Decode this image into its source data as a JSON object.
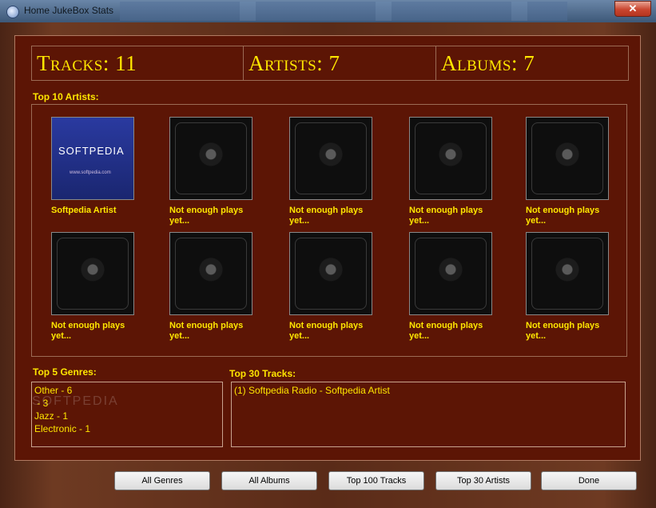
{
  "window": {
    "title": "Home JukeBox Stats",
    "close_glyph": "✕"
  },
  "stats": {
    "tracks": "Tracks: 11",
    "artists": "Artists: 7",
    "albums": "Albums: 7"
  },
  "top_artists": {
    "label": "Top 10 Artists:",
    "items": [
      {
        "name": "Softpedia Artist",
        "cover": "softpedia-cover",
        "logo": "SOFTPEDIA",
        "url": "www.softpedia.com"
      },
      {
        "name": "Not enough plays yet...",
        "cover": "empty-cd-case"
      },
      {
        "name": "Not enough plays yet...",
        "cover": "empty-cd-case"
      },
      {
        "name": "Not enough plays yet...",
        "cover": "empty-cd-case"
      },
      {
        "name": "Not enough plays yet...",
        "cover": "empty-cd-case"
      },
      {
        "name": "Not enough plays yet...",
        "cover": "empty-cd-case"
      },
      {
        "name": "Not enough plays yet...",
        "cover": "empty-cd-case"
      },
      {
        "name": "Not enough plays yet...",
        "cover": "empty-cd-case"
      },
      {
        "name": "Not enough plays yet...",
        "cover": "empty-cd-case"
      },
      {
        "name": "Not enough plays yet...",
        "cover": "empty-cd-case"
      }
    ]
  },
  "genres": {
    "label": "Top 5 Genres:",
    "items": [
      "Other - 6",
      " - 3",
      "Jazz - 1",
      "Electronic - 1"
    ]
  },
  "tracks": {
    "label": "Top 30 Tracks:",
    "items": [
      "(1) Softpedia Radio - Softpedia Artist"
    ]
  },
  "buttons": {
    "all_genres": "All Genres",
    "all_albums": "All Albums",
    "top100_tracks": "Top 100 Tracks",
    "top30_artists": "Top 30 Artists",
    "done": "Done"
  },
  "watermark": "SOFTPEDIA",
  "colors": {
    "accent": "#ffe600",
    "panel": "#5c1505"
  }
}
